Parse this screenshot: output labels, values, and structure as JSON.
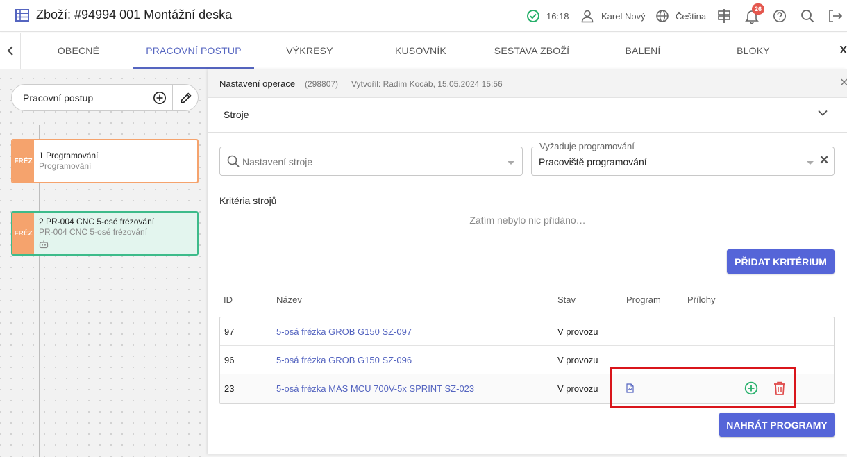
{
  "header": {
    "title": "Zboží: #94994 001 Montážní deska",
    "time": "16:18",
    "user": "Karel Nový",
    "language": "Čeština",
    "notification_count": "26"
  },
  "tabs": [
    {
      "label": "OBECNÉ"
    },
    {
      "label": "PRACOVNÍ POSTUP"
    },
    {
      "label": "VÝKRESY"
    },
    {
      "label": "KUSOVNÍK"
    },
    {
      "label": "SESTAVA ZBOŽÍ"
    },
    {
      "label": "BALENÍ"
    },
    {
      "label": "BLOKY"
    }
  ],
  "tab_next_label": "X",
  "workflow": {
    "title": "Pracovní postup",
    "operations": [
      {
        "badge": "FRÉZ",
        "title": "1 Programování",
        "subtitle": "Programování"
      },
      {
        "badge": "FRÉZ",
        "title": "2 PR-004 CNC 5-osé frézování",
        "subtitle": "PR-004 CNC 5-osé frézování"
      }
    ]
  },
  "panel": {
    "title": "Nastavení operace",
    "id": "(298807)",
    "created": "Vytvořil: Radim Kocáb, 15.05.2024 15:56",
    "close": "×",
    "section_title": "Stroje",
    "machine_search_placeholder": "Nastavení stroje",
    "workplace_label": "Vyžaduje programování",
    "workplace_value": "Pracoviště programování",
    "workplace_clear": "✕",
    "criteria_title": "Kritéria strojů",
    "criteria_empty": "Zatím nebylo nic přidáno…",
    "add_criterion": "PŘIDAT KRITÉRIUM",
    "upload_programs": "NAHRÁT PROGRAMY"
  },
  "table": {
    "headers": {
      "id": "ID",
      "name": "Název",
      "status": "Stav",
      "program": "Program",
      "attachments": "Přílohy"
    },
    "rows": [
      {
        "id": "97",
        "name": "5-osá frézka GROB G150 SZ-097",
        "status": "V provozu"
      },
      {
        "id": "96",
        "name": "5-osá frézka GROB G150 SZ-096",
        "status": "V provozu"
      },
      {
        "id": "23",
        "name": "5-osá frézka MAS MCU 700V-5x SPRINT SZ-023",
        "status": "V provozu"
      }
    ]
  },
  "colors": {
    "accent": "#5565d8",
    "op_badge": "#f5a36d",
    "op1_border": "#f5a36d",
    "op2_border": "#3dbb8a",
    "add_icon": "#27b06b",
    "delete_icon": "#e04b4b",
    "highlight": "#d9151b",
    "notification": "#e4574e",
    "status_ok": "#27b06b"
  },
  "icons": [
    "table-icon",
    "check-circle-icon",
    "user-icon",
    "globe-icon",
    "signpost-icon",
    "bell-icon",
    "help-icon",
    "search-icon",
    "logout-icon",
    "chevron-left-icon",
    "plus-circle-icon",
    "pencil-icon",
    "robot-icon",
    "chevron-down-icon",
    "file-icon",
    "trash-icon"
  ]
}
